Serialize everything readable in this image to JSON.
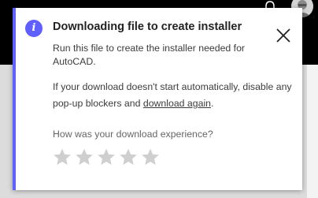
{
  "toast": {
    "title": "Downloading file to create installer",
    "description": "Run this file to create the installer needed for AutoCAD.",
    "hint_text_before": "If your download doesn't start automatically, disable any pop-up blockers and ",
    "hint_link": "download again",
    "hint_text_after": ".",
    "rating_question": "How was your download experience?",
    "rating": {
      "selected": 0,
      "max": 5
    },
    "icons": {
      "info": "info-icon",
      "close": "close-icon",
      "star": "star-icon"
    },
    "info_glyph": "i"
  },
  "colors": {
    "accent": "#5f60ff",
    "header_bg": "#000000",
    "star_empty": "#cfcfcf",
    "text": "#3c3c3c"
  }
}
